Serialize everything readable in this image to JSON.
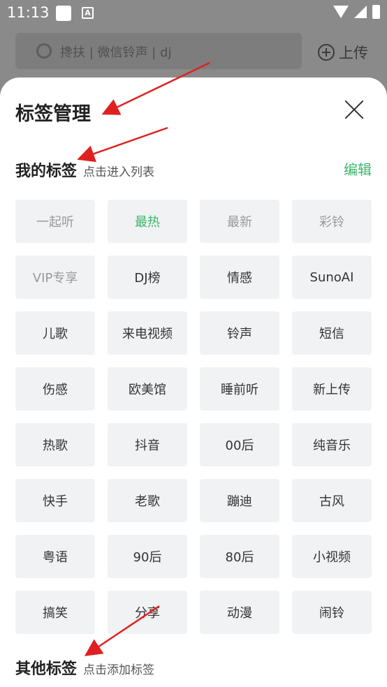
{
  "status_bar": {
    "time": "11:13",
    "a_icon": "A"
  },
  "background": {
    "search_placeholder": "搀扶 | 微信铃声 | dj",
    "upload_label": "上传"
  },
  "sheet": {
    "title": "标签管理",
    "my_tags": {
      "heading": "我的标签",
      "hint": "点击进入列表",
      "edit_label": "编辑"
    },
    "tags": [
      {
        "label": "一起听",
        "state": "muted"
      },
      {
        "label": "最热",
        "state": "active"
      },
      {
        "label": "最新",
        "state": "muted"
      },
      {
        "label": "彩铃",
        "state": "muted"
      },
      {
        "label": "VIP专享",
        "state": "muted"
      },
      {
        "label": "DJ榜",
        "state": "normal"
      },
      {
        "label": "情感",
        "state": "normal"
      },
      {
        "label": "SunoAI",
        "state": "normal"
      },
      {
        "label": "儿歌",
        "state": "normal"
      },
      {
        "label": "来电视频",
        "state": "normal"
      },
      {
        "label": "铃声",
        "state": "normal"
      },
      {
        "label": "短信",
        "state": "normal"
      },
      {
        "label": "伤感",
        "state": "normal"
      },
      {
        "label": "欧美馆",
        "state": "normal"
      },
      {
        "label": "睡前听",
        "state": "normal"
      },
      {
        "label": "新上传",
        "state": "normal"
      },
      {
        "label": "热歌",
        "state": "normal"
      },
      {
        "label": "抖音",
        "state": "normal"
      },
      {
        "label": "00后",
        "state": "normal"
      },
      {
        "label": "纯音乐",
        "state": "normal"
      },
      {
        "label": "快手",
        "state": "normal"
      },
      {
        "label": "老歌",
        "state": "normal"
      },
      {
        "label": "蹦迪",
        "state": "normal"
      },
      {
        "label": "古风",
        "state": "normal"
      },
      {
        "label": "粤语",
        "state": "normal"
      },
      {
        "label": "90后",
        "state": "normal"
      },
      {
        "label": "80后",
        "state": "normal"
      },
      {
        "label": "小视频",
        "state": "normal"
      },
      {
        "label": "搞笑",
        "state": "normal"
      },
      {
        "label": "分享",
        "state": "normal"
      },
      {
        "label": "动漫",
        "state": "normal"
      },
      {
        "label": "闹铃",
        "state": "normal"
      }
    ],
    "other_tags": {
      "heading": "其他标签",
      "hint": "点击添加标签"
    }
  },
  "colors": {
    "accent": "#3ab66a",
    "annotation_arrow": "#e02020"
  }
}
